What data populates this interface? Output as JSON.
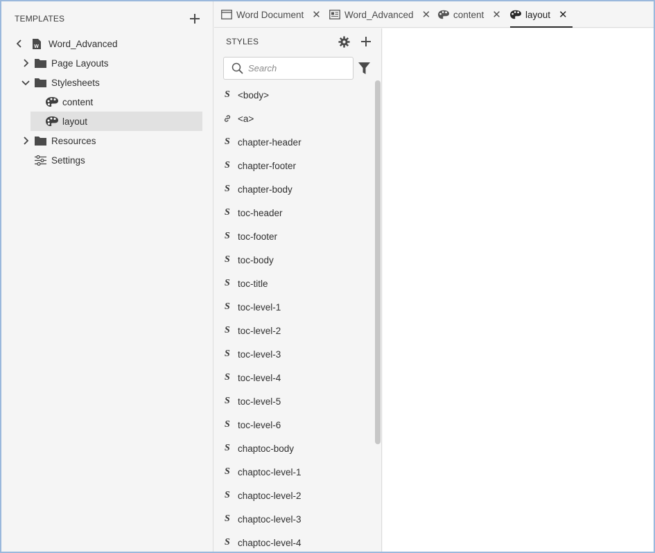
{
  "templates_panel": {
    "title": "TEMPLATES",
    "tree": [
      {
        "label": "Word_Advanced",
        "level": 0,
        "icon": "word-doc-icon",
        "chevron": "left"
      },
      {
        "label": "Page Layouts",
        "level": 1,
        "icon": "folder-icon",
        "chevron": "right"
      },
      {
        "label": "Stylesheets",
        "level": 1,
        "icon": "folder-icon",
        "chevron": "down"
      },
      {
        "label": "content",
        "level": 2,
        "icon": "palette-icon"
      },
      {
        "label": "layout",
        "level": 2,
        "icon": "palette-icon",
        "selected": true
      },
      {
        "label": "Resources",
        "level": 1,
        "icon": "folder-icon",
        "chevron": "right"
      },
      {
        "label": "Settings",
        "level": 1,
        "icon": "sliders-icon"
      }
    ]
  },
  "tabs": [
    {
      "label": "Word Document",
      "icon": "window-icon"
    },
    {
      "label": "Word_Advanced",
      "icon": "template-icon"
    },
    {
      "label": "content",
      "icon": "palette-icon"
    },
    {
      "label": "layout",
      "icon": "palette-icon",
      "active": true
    }
  ],
  "styles_panel": {
    "title": "STYLES",
    "search_placeholder": "Search",
    "items": [
      {
        "label": "<body>",
        "icon": "S"
      },
      {
        "label": "<a>",
        "icon": "link"
      },
      {
        "label": "chapter-header",
        "icon": "S"
      },
      {
        "label": "chapter-footer",
        "icon": "S"
      },
      {
        "label": "chapter-body",
        "icon": "S"
      },
      {
        "label": "toc-header",
        "icon": "S"
      },
      {
        "label": "toc-footer",
        "icon": "S"
      },
      {
        "label": "toc-body",
        "icon": "S"
      },
      {
        "label": "toc-title",
        "icon": "S"
      },
      {
        "label": "toc-level-1",
        "icon": "S"
      },
      {
        "label": "toc-level-2",
        "icon": "S"
      },
      {
        "label": "toc-level-3",
        "icon": "S"
      },
      {
        "label": "toc-level-4",
        "icon": "S"
      },
      {
        "label": "toc-level-5",
        "icon": "S"
      },
      {
        "label": "toc-level-6",
        "icon": "S"
      },
      {
        "label": "chaptoc-body",
        "icon": "S"
      },
      {
        "label": "chaptoc-level-1",
        "icon": "S"
      },
      {
        "label": "chaptoc-level-2",
        "icon": "S"
      },
      {
        "label": "chaptoc-level-3",
        "icon": "S"
      },
      {
        "label": "chaptoc-level-4",
        "icon": "S"
      }
    ]
  },
  "colors": {
    "panel_bg": "#f5f5f5",
    "selected_bg": "#e1e1e1",
    "border": "#9ab8dc",
    "canvas_bg": "#ffffff"
  }
}
